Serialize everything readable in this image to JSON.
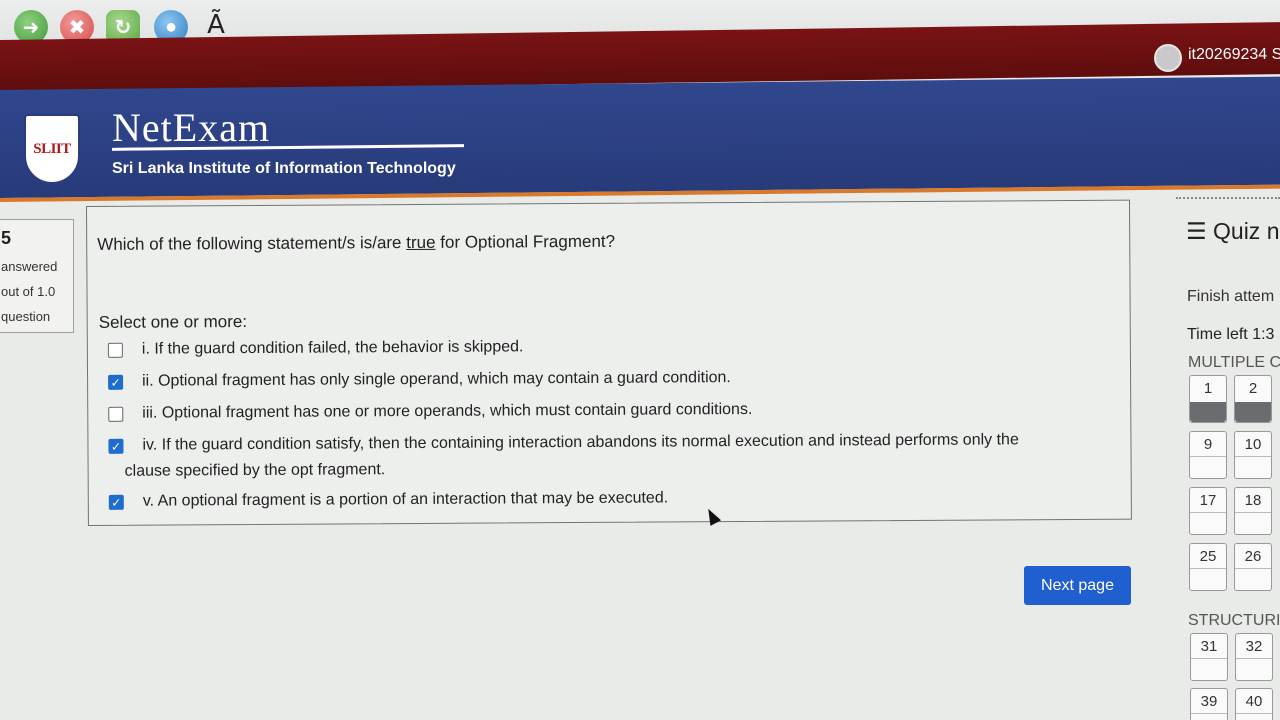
{
  "toolbar": {
    "char_icon": "Ã",
    "icons": [
      "back-arrow-icon",
      "stop-icon",
      "reload-icon",
      "home-globe-icon"
    ]
  },
  "user": {
    "name": "it20269234 S"
  },
  "header": {
    "brand": "NetExam",
    "subtitle": "Sri Lanka Institute of Information Technology",
    "logo_text": "SLIIT"
  },
  "question_info": {
    "number": "5",
    "status": "answered",
    "marks": "out of 1.0",
    "flag": "question"
  },
  "question": {
    "text_before": "Which of the following statement/s is/are ",
    "text_emph": "true",
    "text_after": " for Optional Fragment?",
    "select_label": "Select one or more:",
    "options": [
      {
        "label": "i. If the guard condition failed, the behavior is skipped.",
        "checked": false
      },
      {
        "label": "ii. Optional fragment has only single operand, which may contain a guard condition.",
        "checked": true
      },
      {
        "label": "iii. Optional fragment has one or more operands, which must contain guard conditions.",
        "checked": false
      },
      {
        "label": "iv. If the guard condition satisfy, then the containing interaction abandons its normal execution and instead performs only the",
        "label2": "clause specified by the opt fragment.",
        "checked": true
      },
      {
        "label": "v. An optional fragment is a portion of an interaction that may be executed.",
        "checked": true
      }
    ]
  },
  "next_button": "Next page",
  "quiz_nav": {
    "title": "Quiz n",
    "finish": "Finish attem",
    "time_left": "Time left 1:3",
    "section_mcq": "MULTIPLE C",
    "section_structured": "STRUCTURI",
    "cells": [
      "1",
      "2",
      "9",
      "10",
      "17",
      "18",
      "25",
      "26",
      "31",
      "32",
      "39",
      "40"
    ]
  },
  "colors": {
    "maroon": "#6e1011",
    "header_blue": "#2d4285",
    "accent_orange": "#d9792c",
    "checkbox_blue": "#1f6ccf",
    "button_blue": "#1f5fd0"
  }
}
